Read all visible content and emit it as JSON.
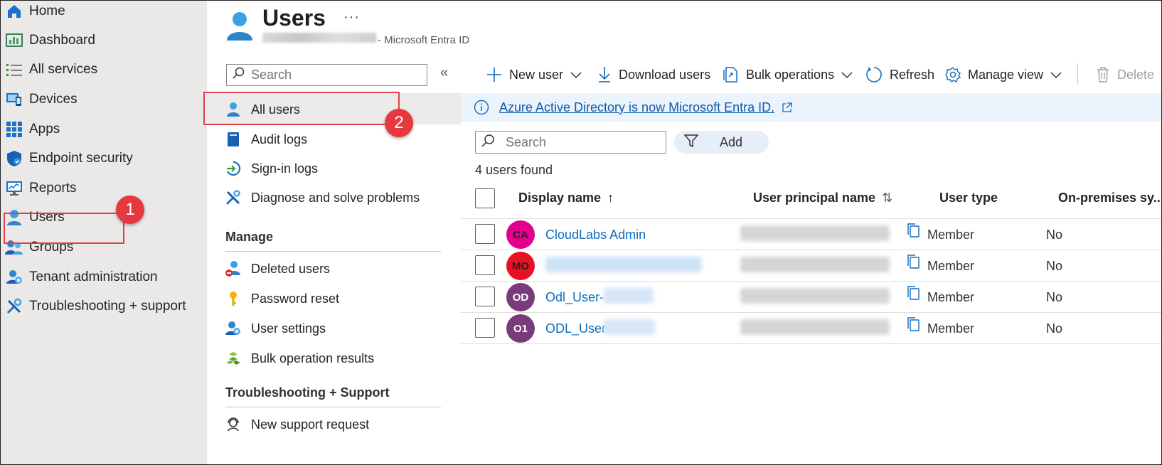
{
  "leftnav": {
    "items": [
      {
        "label": "Home",
        "icon": "home-icon"
      },
      {
        "label": "Dashboard",
        "icon": "dashboard-icon"
      },
      {
        "label": "All services",
        "icon": "list-icon"
      },
      {
        "label": "Devices",
        "icon": "devices-icon"
      },
      {
        "label": "Apps",
        "icon": "apps-grid-icon"
      },
      {
        "label": "Endpoint security",
        "icon": "shield-icon"
      },
      {
        "label": "Reports",
        "icon": "reports-icon"
      },
      {
        "label": "Users",
        "icon": "user-icon"
      },
      {
        "label": "Groups",
        "icon": "groups-icon"
      },
      {
        "label": "Tenant administration",
        "icon": "tenant-gear-icon"
      },
      {
        "label": "Troubleshooting + support",
        "icon": "wrench-icon"
      }
    ]
  },
  "annotations": {
    "step1": "1",
    "step2": "2",
    "highlight_color": "#e0404a"
  },
  "header": {
    "title": "Users",
    "more": "···",
    "subtitle": "- Microsoft Entra ID"
  },
  "subnav": {
    "search_placeholder": "Search",
    "collapse": "«",
    "top_items": [
      {
        "label": "All users"
      },
      {
        "label": "Audit logs"
      },
      {
        "label": "Sign-in logs"
      },
      {
        "label": "Diagnose and solve problems"
      }
    ],
    "manage_heading": "Manage",
    "manage_items": [
      {
        "label": "Deleted users"
      },
      {
        "label": "Password reset"
      },
      {
        "label": "User settings"
      },
      {
        "label": "Bulk operation results"
      }
    ],
    "support_heading": "Troubleshooting + Support",
    "support_items": [
      {
        "label": "New support request"
      }
    ]
  },
  "toolbar": {
    "new_user": "New user",
    "download_users": "Download users",
    "bulk_operations": "Bulk operations",
    "refresh": "Refresh",
    "manage_view": "Manage view",
    "delete": "Delete"
  },
  "banner": {
    "text": "Azure Active Directory is now Microsoft Entra ID."
  },
  "list": {
    "search_placeholder": "Search",
    "filter_label": "Add",
    "count_text": "4 users found",
    "columns": {
      "display_name": "Display name",
      "display_name_sort": "↑",
      "upn": "User principal name",
      "upn_sort": "⇅",
      "user_type": "User type",
      "onprem": "On-premises sy..."
    },
    "rows": [
      {
        "initials": "CA",
        "avatar_color": "#e3008c",
        "name": "CloudLabs Admin",
        "user_type": "Member",
        "onprem": "No"
      },
      {
        "initials": "MO",
        "avatar_color": "#e81123",
        "name": "",
        "user_type": "Member",
        "onprem": "No"
      },
      {
        "initials": "OD",
        "avatar_color": "#7a3b7c",
        "name": "Odl_User-",
        "user_type": "Member",
        "onprem": "No"
      },
      {
        "initials": "O1",
        "avatar_color": "#7a3b7c",
        "name": "ODL_User",
        "user_type": "Member",
        "onprem": "No"
      }
    ]
  },
  "colors": {
    "accent": "#0f6cbd",
    "nav_bg": "#eae9e8",
    "banner_bg": "#ebf3fc"
  }
}
